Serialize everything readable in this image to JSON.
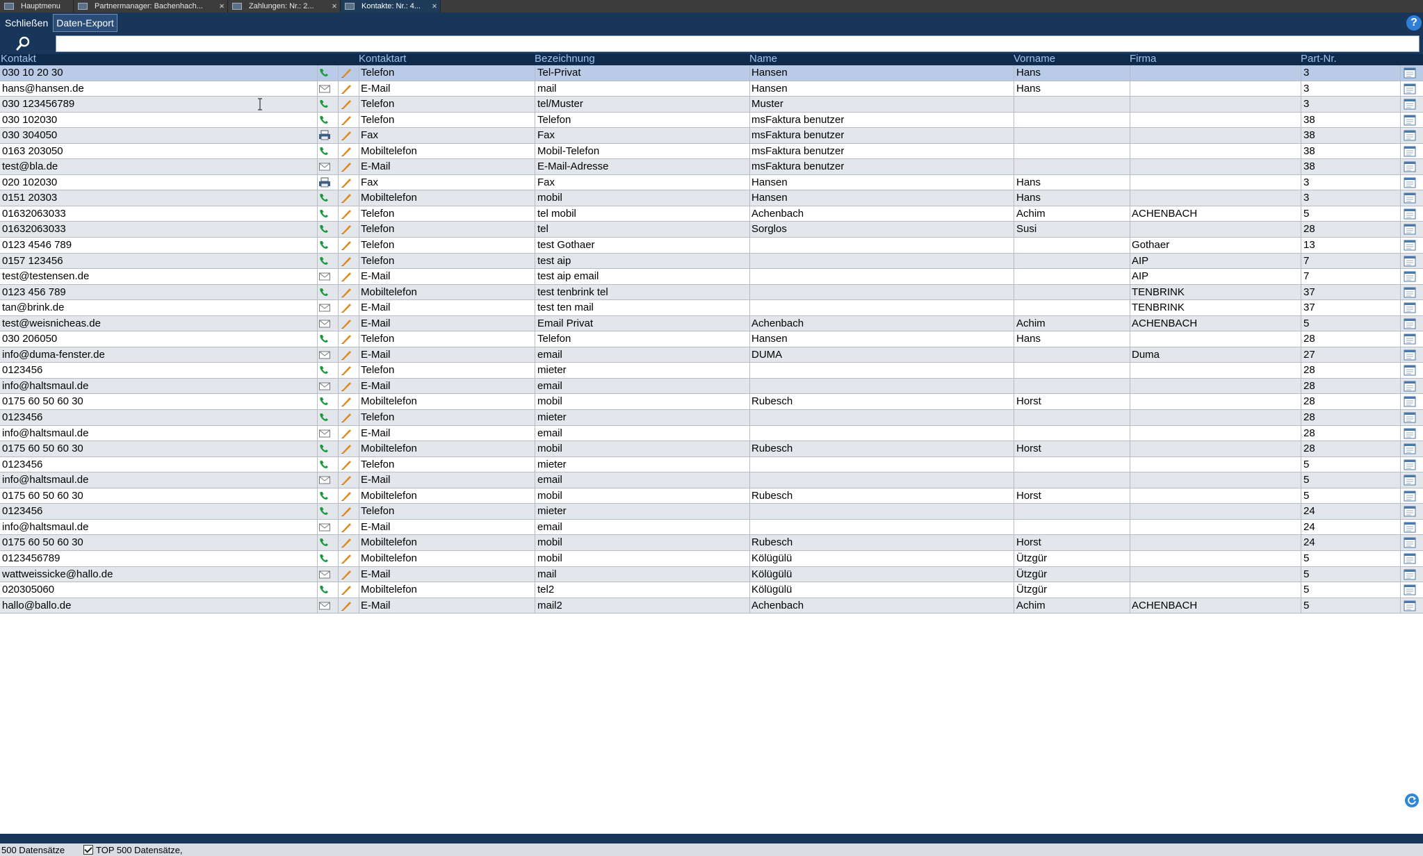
{
  "tabs": [
    {
      "label": "Hauptmenu",
      "closable": false
    },
    {
      "label": "Partnermanager: Bachenhach...",
      "closable": true
    },
    {
      "label": "Zahlungen: Nr.: 2...",
      "closable": true
    },
    {
      "label": "Kontakte: Nr.: 4...",
      "closable": true,
      "active": true
    }
  ],
  "toolbar": {
    "close_label": "Schließen",
    "export_label": "Daten-Export",
    "help_label": "?"
  },
  "search": {
    "value": "",
    "placeholder": ""
  },
  "columns": {
    "kontakt": "Kontakt",
    "kontaktart": "Kontaktart",
    "bezeichnung": "Bezeichnung",
    "name": "Name",
    "vorname": "Vorname",
    "firma": "Firma",
    "partnr": "Part-Nr."
  },
  "rows": [
    {
      "kontakt": "030 10 20 30",
      "icon": "phone",
      "kontaktart": "Telefon",
      "bezeichnung": "Tel-Privat",
      "name": "Hansen",
      "vorname": "Hans",
      "firma": "",
      "partnr": "3"
    },
    {
      "kontakt": "hans@hansen.de",
      "icon": "mail",
      "kontaktart": "E-Mail",
      "bezeichnung": "mail",
      "name": "Hansen",
      "vorname": "Hans",
      "firma": "",
      "partnr": "3"
    },
    {
      "kontakt": "030 123456789",
      "icon": "phone",
      "kontaktart": "Telefon",
      "bezeichnung": "tel/Muster",
      "name": "Muster",
      "vorname": "",
      "firma": "",
      "partnr": "3"
    },
    {
      "kontakt": "030 102030",
      "icon": "phone",
      "kontaktart": "Telefon",
      "bezeichnung": "Telefon",
      "name": "msFaktura benutzer",
      "vorname": "",
      "firma": "",
      "partnr": "38"
    },
    {
      "kontakt": "030 304050",
      "icon": "fax",
      "kontaktart": "Fax",
      "bezeichnung": "Fax",
      "name": "msFaktura benutzer",
      "vorname": "",
      "firma": "",
      "partnr": "38"
    },
    {
      "kontakt": "0163 203050",
      "icon": "phone",
      "kontaktart": "Mobiltelefon",
      "bezeichnung": "Mobil-Telefon",
      "name": "msFaktura benutzer",
      "vorname": "",
      "firma": "",
      "partnr": "38"
    },
    {
      "kontakt": "test@bla.de",
      "icon": "mail",
      "kontaktart": "E-Mail",
      "bezeichnung": "E-Mail-Adresse",
      "name": "msFaktura benutzer",
      "vorname": "",
      "firma": "",
      "partnr": "38"
    },
    {
      "kontakt": "020 102030",
      "icon": "fax",
      "kontaktart": "Fax",
      "bezeichnung": "Fax",
      "name": "Hansen",
      "vorname": "Hans",
      "firma": "",
      "partnr": "3"
    },
    {
      "kontakt": "0151 20303",
      "icon": "phone",
      "kontaktart": "Mobiltelefon",
      "bezeichnung": "mobil",
      "name": "Hansen",
      "vorname": "Hans",
      "firma": "",
      "partnr": "3"
    },
    {
      "kontakt": "01632063033",
      "icon": "phone",
      "kontaktart": "Telefon",
      "bezeichnung": "tel mobil",
      "name": "Achenbach",
      "vorname": "Achim",
      "firma": "ACHENBACH",
      "partnr": "5"
    },
    {
      "kontakt": "01632063033",
      "icon": "phone",
      "kontaktart": "Telefon",
      "bezeichnung": "tel",
      "name": "Sorglos",
      "vorname": "Susi",
      "firma": "",
      "partnr": "28"
    },
    {
      "kontakt": "0123 4546 789",
      "icon": "phone",
      "kontaktart": "Telefon",
      "bezeichnung": "test Gothaer",
      "name": "",
      "vorname": "",
      "firma": "Gothaer",
      "partnr": "13"
    },
    {
      "kontakt": "0157 123456",
      "icon": "phone",
      "kontaktart": "Telefon",
      "bezeichnung": "test aip",
      "name": "",
      "vorname": "",
      "firma": "AIP",
      "partnr": "7"
    },
    {
      "kontakt": "test@testensen.de",
      "icon": "mail",
      "kontaktart": "E-Mail",
      "bezeichnung": "test aip email",
      "name": "",
      "vorname": "",
      "firma": "AIP",
      "partnr": "7"
    },
    {
      "kontakt": "0123 456 789",
      "icon": "phone",
      "kontaktart": "Mobiltelefon",
      "bezeichnung": "test tenbrink tel",
      "name": "",
      "vorname": "",
      "firma": "TENBRINK",
      "partnr": "37"
    },
    {
      "kontakt": "tan@brink.de",
      "icon": "mail",
      "kontaktart": "E-Mail",
      "bezeichnung": "test ten mail",
      "name": "",
      "vorname": "",
      "firma": "TENBRINK",
      "partnr": "37"
    },
    {
      "kontakt": "test@weisnicheas.de",
      "icon": "mail",
      "kontaktart": "E-Mail",
      "bezeichnung": "Email Privat",
      "name": "Achenbach",
      "vorname": "Achim",
      "firma": "ACHENBACH",
      "partnr": "5"
    },
    {
      "kontakt": "030 206050",
      "icon": "phone",
      "kontaktart": "Telefon",
      "bezeichnung": "Telefon",
      "name": "Hansen",
      "vorname": "Hans",
      "firma": "",
      "partnr": "28"
    },
    {
      "kontakt": "info@duma-fenster.de",
      "icon": "mail",
      "kontaktart": "E-Mail",
      "bezeichnung": "email",
      "name": "DUMA",
      "vorname": "",
      "firma": "Duma",
      "partnr": "27"
    },
    {
      "kontakt": "0123456",
      "icon": "phone",
      "kontaktart": "Telefon",
      "bezeichnung": "mieter",
      "name": "",
      "vorname": "",
      "firma": "",
      "partnr": "28"
    },
    {
      "kontakt": "info@haltsmaul.de",
      "icon": "mail",
      "kontaktart": "E-Mail",
      "bezeichnung": "email",
      "name": "",
      "vorname": "",
      "firma": "",
      "partnr": "28"
    },
    {
      "kontakt": "0175 60 50 60 30",
      "icon": "phone",
      "kontaktart": "Mobiltelefon",
      "bezeichnung": "mobil",
      "name": "Rubesch",
      "vorname": "Horst",
      "firma": "",
      "partnr": "28"
    },
    {
      "kontakt": "0123456",
      "icon": "phone",
      "kontaktart": "Telefon",
      "bezeichnung": "mieter",
      "name": "",
      "vorname": "",
      "firma": "",
      "partnr": "28"
    },
    {
      "kontakt": "info@haltsmaul.de",
      "icon": "mail",
      "kontaktart": "E-Mail",
      "bezeichnung": "email",
      "name": "",
      "vorname": "",
      "firma": "",
      "partnr": "28"
    },
    {
      "kontakt": "0175 60 50 60 30",
      "icon": "phone",
      "kontaktart": "Mobiltelefon",
      "bezeichnung": "mobil",
      "name": "Rubesch",
      "vorname": "Horst",
      "firma": "",
      "partnr": "28"
    },
    {
      "kontakt": "0123456",
      "icon": "phone",
      "kontaktart": "Telefon",
      "bezeichnung": "mieter",
      "name": "",
      "vorname": "",
      "firma": "",
      "partnr": "5"
    },
    {
      "kontakt": "info@haltsmaul.de",
      "icon": "mail",
      "kontaktart": "E-Mail",
      "bezeichnung": "email",
      "name": "",
      "vorname": "",
      "firma": "",
      "partnr": "5"
    },
    {
      "kontakt": "0175 60 50 60 30",
      "icon": "phone",
      "kontaktart": "Mobiltelefon",
      "bezeichnung": "mobil",
      "name": "Rubesch",
      "vorname": "Horst",
      "firma": "",
      "partnr": "5"
    },
    {
      "kontakt": "0123456",
      "icon": "phone",
      "kontaktart": "Telefon",
      "bezeichnung": "mieter",
      "name": "",
      "vorname": "",
      "firma": "",
      "partnr": "24"
    },
    {
      "kontakt": "info@haltsmaul.de",
      "icon": "mail",
      "kontaktart": "E-Mail",
      "bezeichnung": "email",
      "name": "",
      "vorname": "",
      "firma": "",
      "partnr": "24"
    },
    {
      "kontakt": "0175 60 50 60 30",
      "icon": "phone",
      "kontaktart": "Mobiltelefon",
      "bezeichnung": "mobil",
      "name": "Rubesch",
      "vorname": "Horst",
      "firma": "",
      "partnr": "24"
    },
    {
      "kontakt": "0123456789",
      "icon": "phone",
      "kontaktart": "Mobiltelefon",
      "bezeichnung": "mobil",
      "name": "Kölügülü",
      "vorname": "Ützgür",
      "firma": "",
      "partnr": "5"
    },
    {
      "kontakt": "wattweissicke@hallo.de",
      "icon": "mail",
      "kontaktart": "E-Mail",
      "bezeichnung": "mail",
      "name": "Kölügülü",
      "vorname": "Ützgür",
      "firma": "",
      "partnr": "5"
    },
    {
      "kontakt": "020305060",
      "icon": "phone",
      "kontaktart": "Mobiltelefon",
      "bezeichnung": "tel2",
      "name": "Kölügülü",
      "vorname": "Ützgür",
      "firma": "",
      "partnr": "5"
    },
    {
      "kontakt": "hallo@ballo.de",
      "icon": "mail",
      "kontaktart": "E-Mail",
      "bezeichnung": "mail2",
      "name": "Achenbach",
      "vorname": "Achim",
      "firma": "ACHENBACH",
      "partnr": "5"
    }
  ],
  "status": {
    "count": "500 Datensätze",
    "filter": "TOP 500 Datensätze,"
  },
  "colors": {
    "toolbar": "#17365a",
    "header": "#0f2a4a",
    "header_text": "#9fc4ee",
    "selected_row": "#b9cbe6",
    "odd_row": "#e3e6ea",
    "phone_icon": "#1a9a3a",
    "edit_icon": "#e08a1e"
  }
}
